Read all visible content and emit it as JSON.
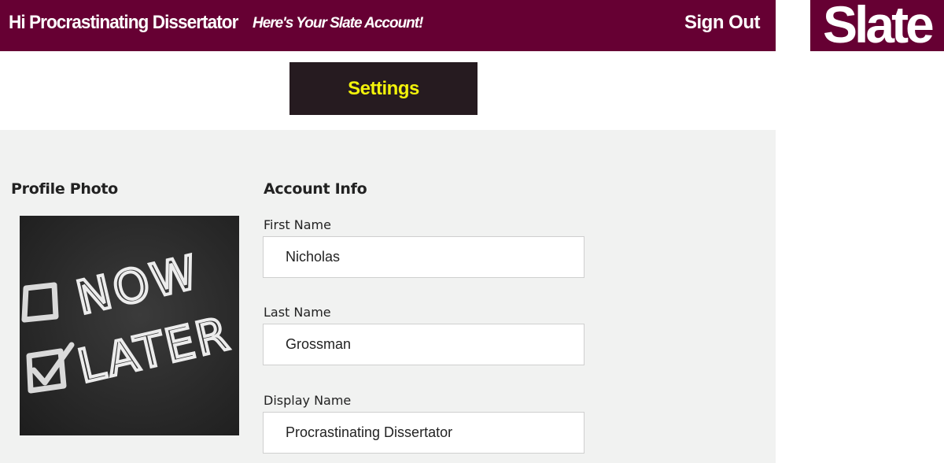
{
  "header": {
    "greeting": "Hi Procrastinating Dissertator",
    "tagline": "Here's Your Slate Account!",
    "sign_out": "Sign Out"
  },
  "logo": {
    "text": "Slate"
  },
  "tabs": {
    "settings": "Settings"
  },
  "profile": {
    "title": "Profile Photo",
    "photo_words": [
      "NOW",
      "LATER"
    ]
  },
  "account": {
    "title": "Account Info",
    "fields": [
      {
        "label": "First Name",
        "value": "Nicholas"
      },
      {
        "label": "Last Name",
        "value": "Grossman"
      },
      {
        "label": "Display Name",
        "value": "Procrastinating Dissertator"
      }
    ]
  },
  "colors": {
    "brand": "#660033",
    "tab_background": "#261b20",
    "tab_text": "#f2f20a",
    "panel_background": "#f1f2f1"
  }
}
